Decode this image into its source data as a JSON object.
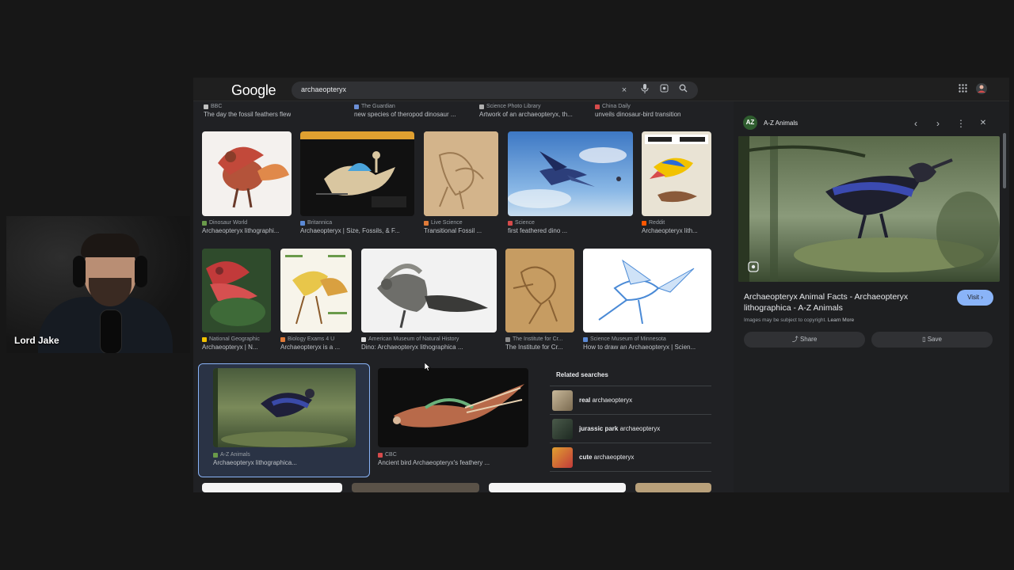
{
  "webcam": {
    "name": "Lord Jake"
  },
  "header": {
    "logo": "Google",
    "query": "archaeopteryx"
  },
  "top_captions": [
    {
      "source": "BBC",
      "title": "The day the fossil feathers flew",
      "color": "#c0c0c0"
    },
    {
      "source": "The Guardian",
      "title": "new species of theropod dinosaur ...",
      "color": "#6c8fd6"
    },
    {
      "source": "Science Photo Library",
      "title": "Artwork of an archaeopteryx, th...",
      "color": "#b0b0b0"
    },
    {
      "source": "China Daily",
      "title": "unveils dinosaur-bird transition",
      "color": "#d64b4b"
    }
  ],
  "row1": [
    {
      "source": "Dinosaur World",
      "title": "Archaeopteryx lithographi...",
      "color": "#6a9a4a"
    },
    {
      "source": "Britannica",
      "title": "Archaeopteryx | Size, Fossils, & F...",
      "color": "#5b8ad6"
    },
    {
      "source": "Live Science",
      "title": "Transitional Fossil ...",
      "color": "#e07b39"
    },
    {
      "source": "Science",
      "title": "first feathered dino ...",
      "color": "#d64b4b"
    },
    {
      "source": "Reddit",
      "title": "Archaeopteryx lith...",
      "color": "#ff5700"
    }
  ],
  "row2": [
    {
      "source": "National Geographic",
      "title": "Archaeopteryx | N...",
      "color": "#f2c200"
    },
    {
      "source": "Biology Exams 4 U",
      "title": "Archaeopteryx is a ...",
      "color": "#e07b39"
    },
    {
      "source": "American Museum of Natural History",
      "title": "Dino: Archaeopteryx lithographica ...",
      "color": "#dddddd"
    },
    {
      "source": "The Institute for Cr...",
      "title": "The Institute for Cr...",
      "color": "#8a8a8a"
    },
    {
      "source": "Science Museum of Minnesota",
      "title": "How to draw an Archaeopteryx | Scien...",
      "color": "#5b8ad6"
    }
  ],
  "row3": [
    {
      "source": "A-Z Animals",
      "title": "Archaeopteryx lithographica...",
      "color": "#6a9a4a"
    },
    {
      "source": "CBC",
      "title": "Ancient bird Archaeopteryx's feathery ...",
      "color": "#d64b4b"
    }
  ],
  "related": {
    "heading": "Related searches",
    "items": [
      {
        "bold": "real",
        "rest": " archaeopteryx"
      },
      {
        "bold": "jurassic park",
        "rest": " archaeopteryx"
      },
      {
        "bold": "cute",
        "rest": " archaeopteryx"
      }
    ]
  },
  "panel": {
    "source": "A-Z Animals",
    "logo_text": "AZ",
    "title": "Archaeopteryx Animal Facts - Archaeopteryx lithographica - A-Z Animals",
    "visit": "Visit",
    "note": "Images may be subject to copyright.",
    "learn_more": "Learn More",
    "share": "Share",
    "save": "Save"
  },
  "icons": {
    "clear": "×",
    "mic": "🎤",
    "lens": "◉",
    "search": "⌕",
    "apps": "⋮⋮",
    "prev": "‹",
    "next": "›",
    "more": "⋮",
    "close": "✕"
  }
}
